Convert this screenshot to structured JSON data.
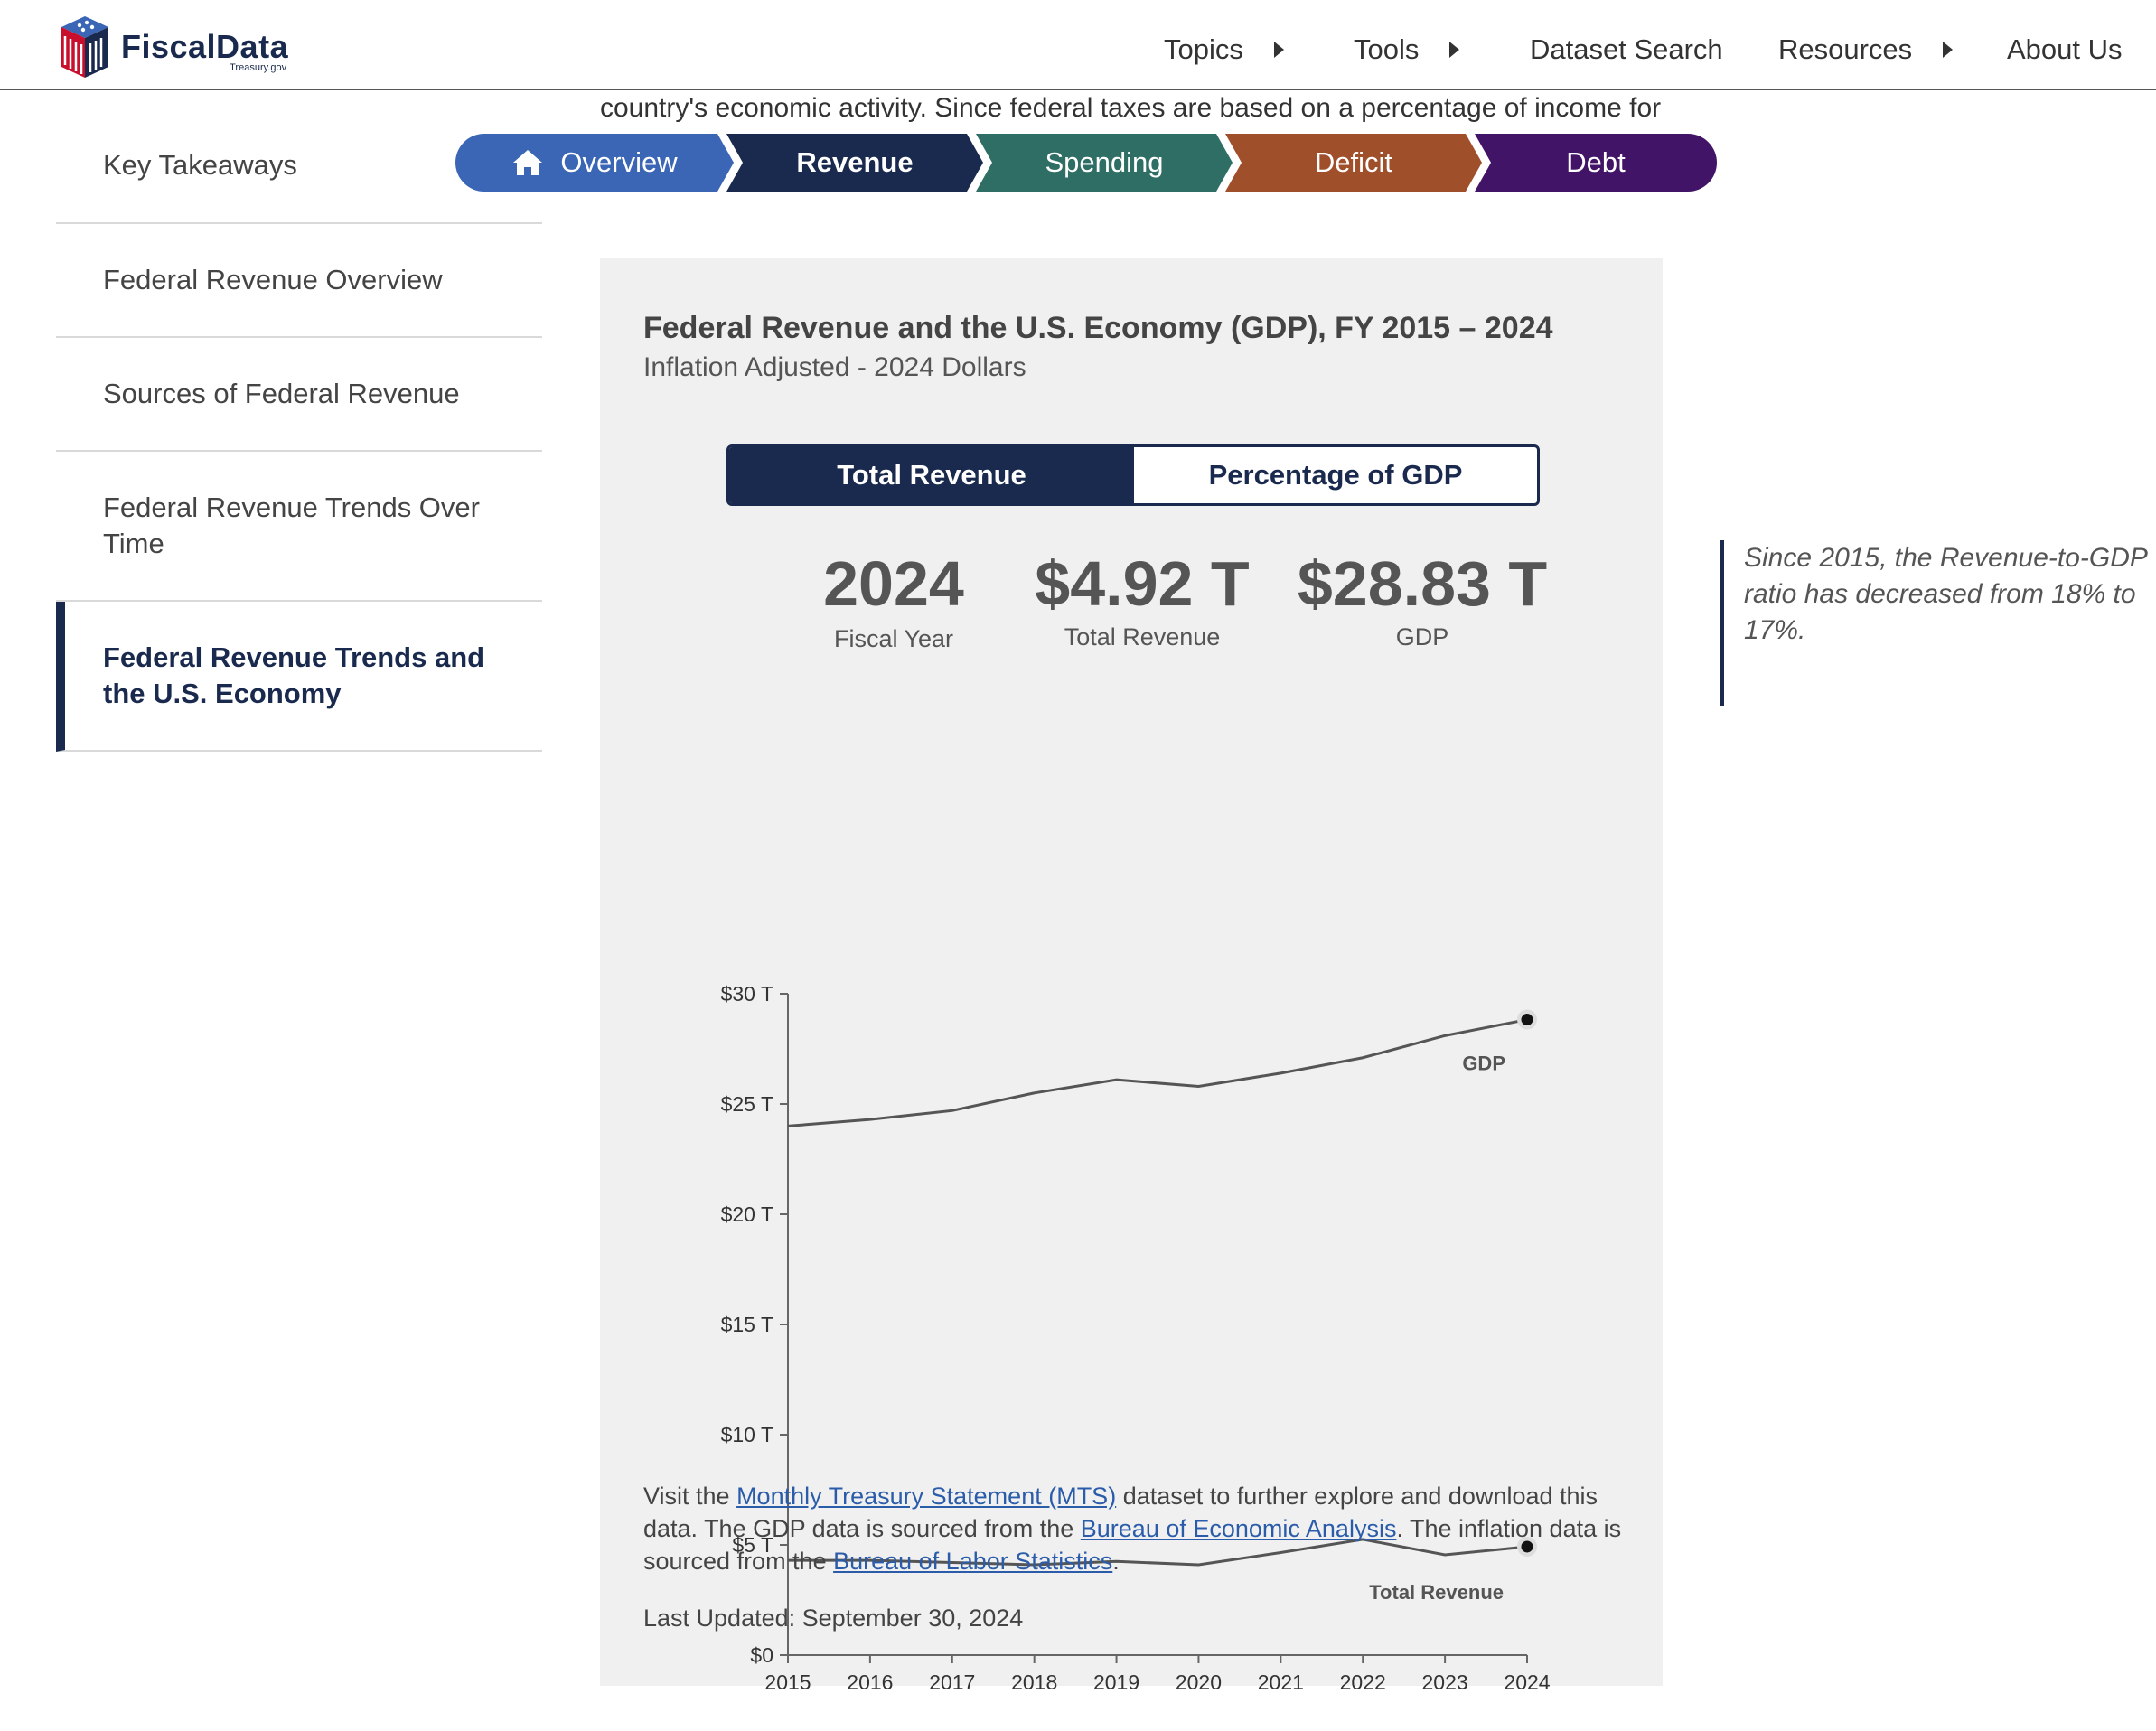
{
  "header": {
    "logo_text": "FiscalData",
    "logo_sub": "Treasury.gov",
    "nav": [
      {
        "label": "Topics"
      },
      {
        "label": "Tools"
      },
      {
        "label": "Dataset Search"
      },
      {
        "label": "Resources"
      },
      {
        "label": "About Us"
      }
    ]
  },
  "intro_text": "country's economic activity. Since federal taxes are based on a percentage of income for",
  "pills": {
    "overview": "Overview",
    "revenue": "Revenue",
    "spending": "Spending",
    "deficit": "Deficit",
    "debt": "Debt"
  },
  "sidebar": {
    "items": [
      {
        "label": "Key Takeaways"
      },
      {
        "label": "Federal Revenue Overview"
      },
      {
        "label": "Sources of Federal Revenue"
      },
      {
        "label": "Federal Revenue Trends Over Time"
      },
      {
        "label": "Federal Revenue Trends and the U.S. Economy"
      }
    ]
  },
  "card": {
    "title": "Federal Revenue and the U.S. Economy (GDP), FY 2015 – 2024",
    "subtitle": "Inflation Adjusted - 2024 Dollars",
    "toggle": {
      "active": "Total Revenue",
      "inactive": "Percentage of GDP"
    },
    "stats": [
      {
        "value": "2024",
        "label": "Fiscal Year"
      },
      {
        "value": "$4.92 T",
        "label": "Total Revenue"
      },
      {
        "value": "$28.83 T",
        "label": "GDP"
      }
    ],
    "footnote": {
      "t1": "Visit the ",
      "link1": "Monthly Treasury Statement (MTS)",
      "t2": " dataset to further explore and download this data. The GDP data is sourced from the ",
      "link2": "Bureau of Economic Analysis",
      "t3": ". The inflation data is sourced from the ",
      "link3": "Bureau of Labor Statistics",
      "t4": "."
    },
    "last_updated": "Last Updated: September 30, 2024"
  },
  "callout": "Since 2015, the Revenue-to-GDP ratio has decreased from 18% to 17%.",
  "colors": {
    "navy": "#1a2a4e",
    "overview": "#3a66b5",
    "spending": "#2f6e64",
    "deficit": "#a04f2b",
    "debt": "#421467",
    "line": "#555555"
  },
  "chart_data": {
    "type": "line",
    "x": [
      2015,
      2016,
      2017,
      2018,
      2019,
      2020,
      2021,
      2022,
      2023,
      2024
    ],
    "series": [
      {
        "name": "GDP",
        "values": [
          24.0,
          24.3,
          24.7,
          25.5,
          26.1,
          25.8,
          26.4,
          27.1,
          28.1,
          28.83
        ]
      },
      {
        "name": "Total Revenue",
        "values": [
          4.3,
          4.3,
          4.2,
          4.1,
          4.25,
          4.1,
          4.65,
          5.25,
          4.55,
          4.92
        ]
      }
    ],
    "y_ticks": [
      "$0",
      "$5 T",
      "$10 T",
      "$15 T",
      "$20 T",
      "$25 T",
      "$30 T"
    ],
    "ylim": [
      0,
      30
    ],
    "xlim": [
      2015,
      2024
    ],
    "grid": false
  }
}
